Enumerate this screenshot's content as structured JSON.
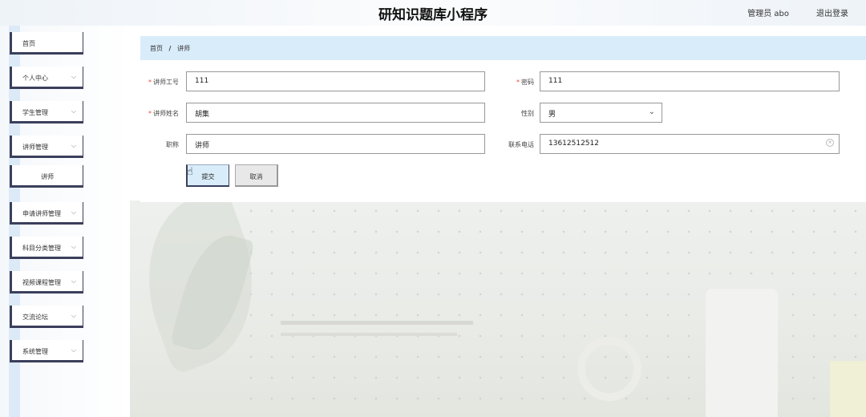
{
  "header": {
    "title": "研知识题库小程序",
    "user": "管理员 abo",
    "logout": "退出登录"
  },
  "sidebar": {
    "items": [
      {
        "label": "首页"
      },
      {
        "label": "个人中心"
      },
      {
        "label": "学生管理"
      },
      {
        "label": "讲师管理"
      },
      {
        "label": "讲师"
      },
      {
        "label": "申请讲师管理"
      },
      {
        "label": "科目分类管理"
      },
      {
        "label": "视频课程管理"
      },
      {
        "label": "交流论坛"
      },
      {
        "label": "系统管理"
      }
    ]
  },
  "breadcrumb": {
    "home": "首页",
    "sep": "/",
    "current": "讲师"
  },
  "form": {
    "teacher_id_label": "讲师工号",
    "teacher_id_value": "111",
    "password_label": "密码",
    "password_value": "111",
    "teacher_name_label": "讲师姓名",
    "teacher_name_value": "胡集",
    "gender_label": "性别",
    "gender_value": "男",
    "title_label": "职称",
    "title_value": "讲师",
    "phone_label": "联系电话",
    "phone_value": "13612512512",
    "required_mark": "*",
    "submit": "提交",
    "cancel": "取消"
  },
  "icons": {
    "chevron": "chevron-down-icon",
    "clear": "clear-icon",
    "cursor": "hand-pointer-icon"
  },
  "colors": {
    "accent": "#d9ecfa",
    "sidebar_border": "#3b3f5c",
    "required": "#e74c3c"
  }
}
